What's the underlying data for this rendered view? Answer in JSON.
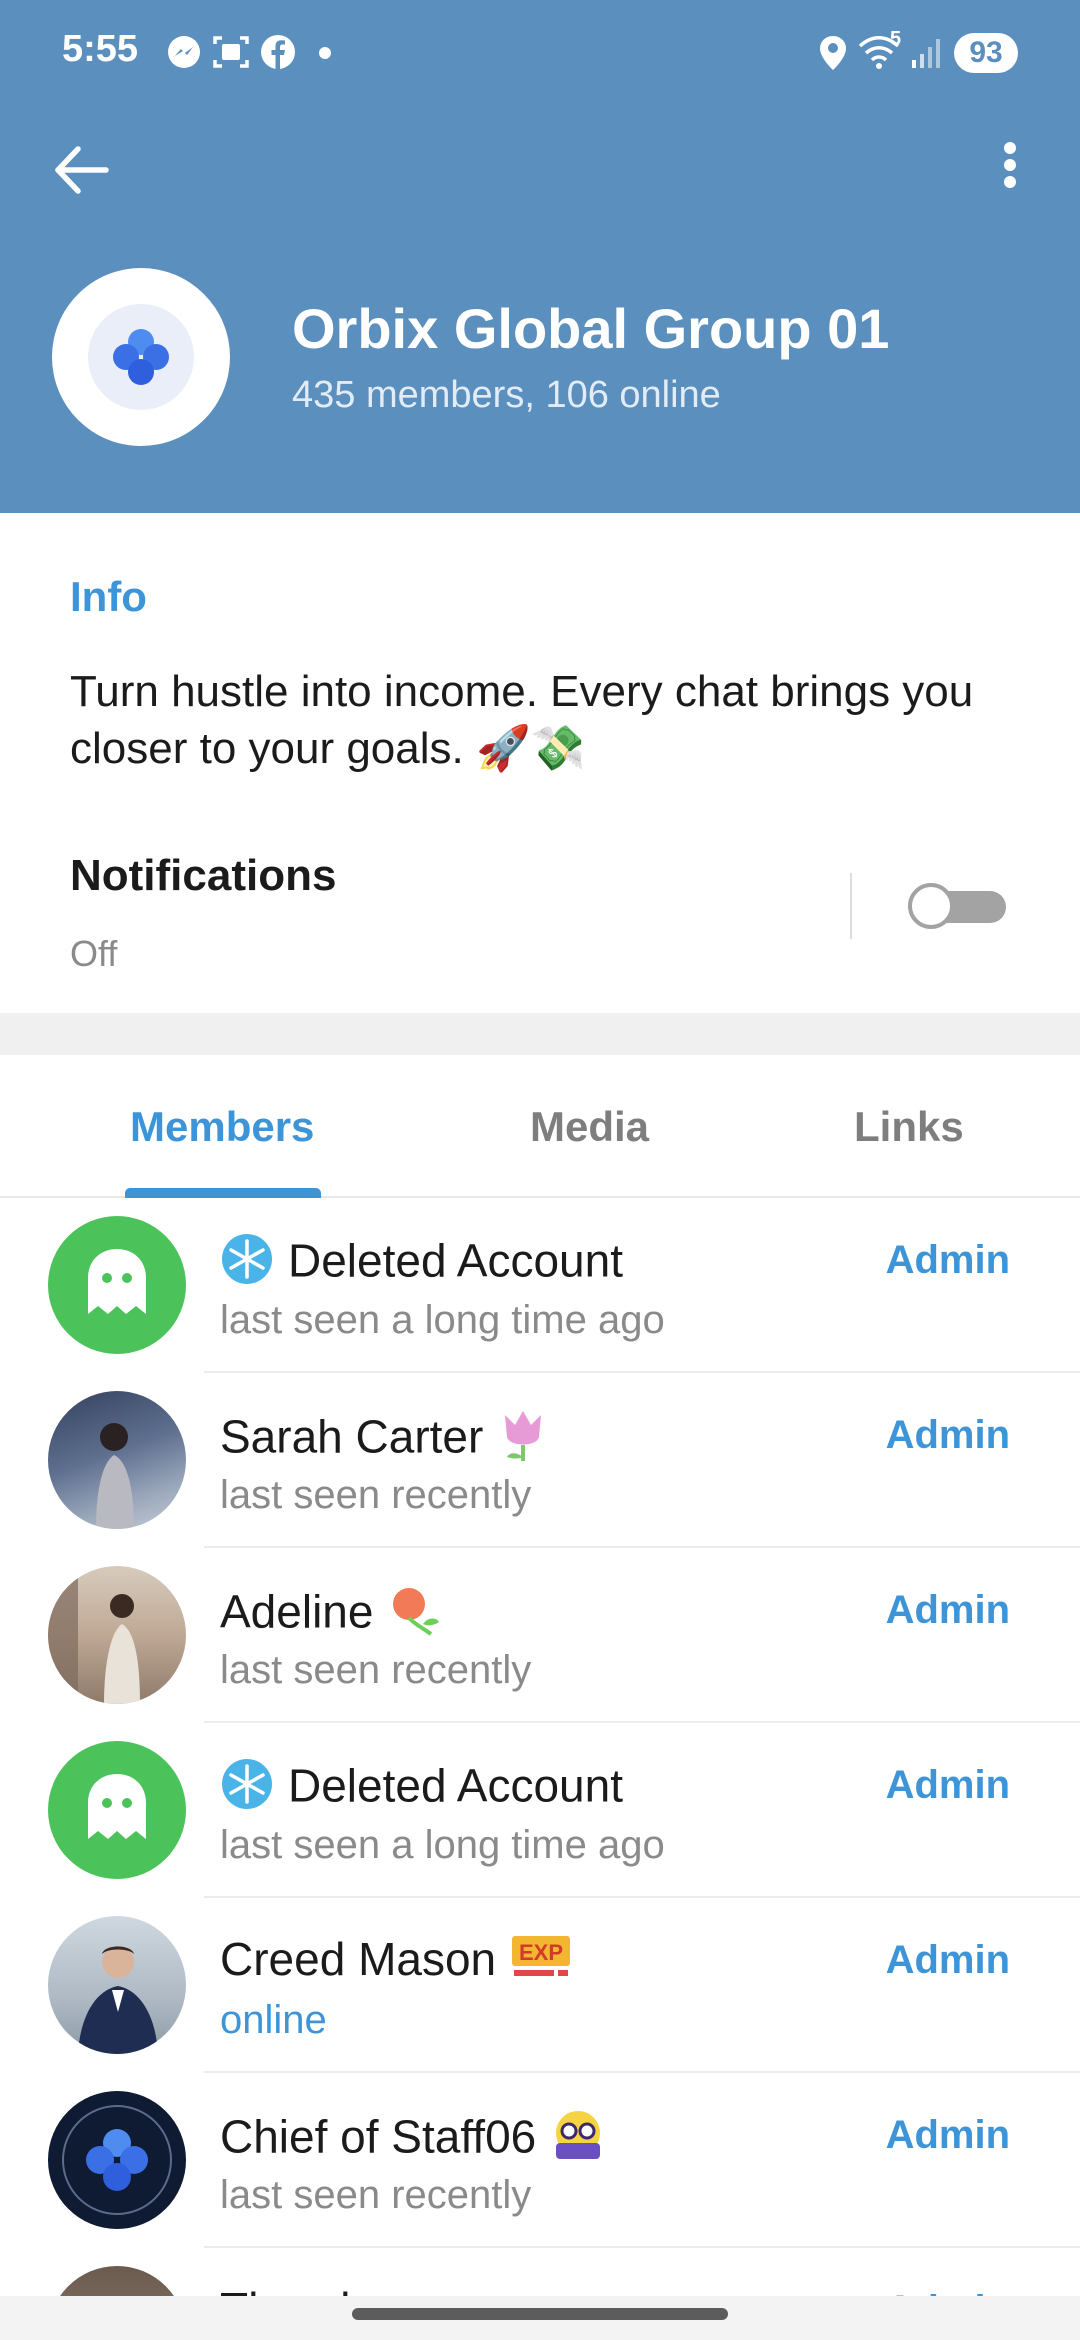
{
  "status_bar": {
    "time": "5:55",
    "notification_icons": [
      "messenger-icon",
      "screenshot-icon",
      "facebook-icon",
      "dot-icon"
    ],
    "right_icons": [
      "location-icon",
      "wifi-icon",
      "signal-icon"
    ],
    "wifi_label": "5",
    "battery": "93"
  },
  "header": {
    "title": "Orbix Global Group 01",
    "subtitle": "435 members, 106 online",
    "back_icon": "arrow-left-icon",
    "menu_icon": "more-vertical-icon",
    "background_color": "#5b8fbd"
  },
  "info": {
    "heading": "Info",
    "description": "Turn hustle into income. Every chat brings you closer to your goals. 🚀💸",
    "notifications_label": "Notifications",
    "notifications_status": "Off",
    "notifications_enabled": false
  },
  "tabs": [
    {
      "label": "Members",
      "active": true
    },
    {
      "label": "Media",
      "active": false
    },
    {
      "label": "Links",
      "active": false
    }
  ],
  "members": [
    {
      "name": "Deleted Account",
      "lead_emoji": "❄️",
      "trail_emoji": "",
      "status": "last seen a long time ago",
      "role": "Admin",
      "online": false,
      "avatar": "ghost"
    },
    {
      "name": "Sarah Carter",
      "lead_emoji": "",
      "trail_emoji": "🌷",
      "status": "last seen recently",
      "role": "Admin",
      "online": false,
      "avatar": "photo"
    },
    {
      "name": "Adeline",
      "lead_emoji": "",
      "trail_emoji": "🌹",
      "status": "last seen recently",
      "role": "Admin",
      "online": false,
      "avatar": "photo"
    },
    {
      "name": "Deleted Account",
      "lead_emoji": "❄️",
      "trail_emoji": "",
      "status": "last seen a long time ago",
      "role": "Admin",
      "online": false,
      "avatar": "ghost"
    },
    {
      "name": "Creed Mason",
      "lead_emoji": "",
      "trail_emoji": "EXP",
      "status": "online",
      "role": "Admin",
      "online": true,
      "avatar": "photo"
    },
    {
      "name": "Chief of Staff06",
      "lead_emoji": "",
      "trail_emoji": "🤓",
      "status": "last seen recently",
      "role": "Admin",
      "online": false,
      "avatar": "logo"
    },
    {
      "name": "Theodore",
      "lead_emoji": "",
      "trail_emoji": "",
      "status": "",
      "role": "Admin",
      "online": false,
      "avatar": "photo"
    }
  ],
  "colors": {
    "accent": "#3d95d8",
    "ghost_avatar": "#4cc35a",
    "online": "#3d95d8"
  }
}
